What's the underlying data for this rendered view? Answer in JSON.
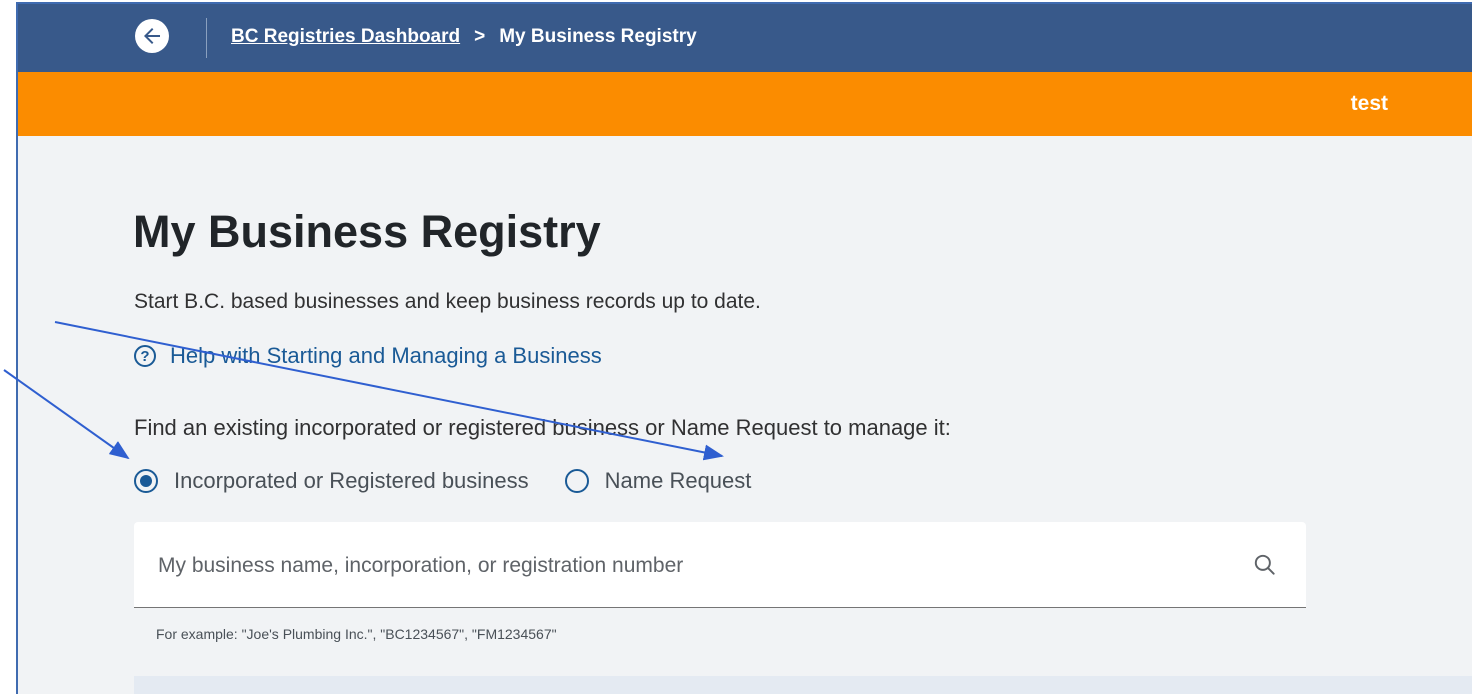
{
  "header": {
    "back_icon": "arrow-left-icon",
    "breadcrumb": {
      "root": "BC Registries Dashboard",
      "separator": ">",
      "current": "My Business Registry"
    },
    "colors": {
      "topbar": "#38598a",
      "accentbar": "#fb8c00"
    }
  },
  "accent_bar": {
    "user_label": "test"
  },
  "main": {
    "title": "My Business Registry",
    "subtitle": "Start B.C. based businesses and keep business records up to date.",
    "help_link": "Help with Starting and Managing a Business",
    "help_icon": "question-circle-icon",
    "find_label": "Find an existing incorporated or registered business or Name Request to manage it:",
    "radio_options": [
      {
        "label": "Incorporated or Registered business",
        "selected": true
      },
      {
        "label": "Name Request",
        "selected": false
      }
    ],
    "search": {
      "placeholder": "My business name, incorporation, or registration number",
      "value": "",
      "icon": "search-icon"
    },
    "hint": "For example: \"Joe's Plumbing Inc.\", \"BC1234567\", \"FM1234567\""
  },
  "annotation": {
    "arrow_color": "#2f5fd0"
  }
}
